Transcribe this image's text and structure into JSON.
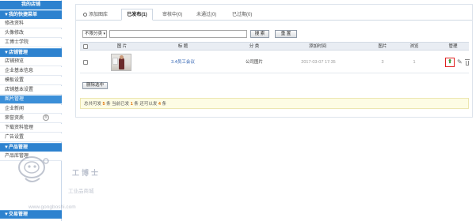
{
  "sidebar": {
    "header": "我的店铺",
    "sections": [
      {
        "label": "▼我的快捷菜单"
      },
      {
        "label": "▼店铺管理"
      },
      {
        "label": "▼产品管理"
      },
      {
        "label": "▼交易管理"
      }
    ],
    "items": [
      {
        "label": "修改资料"
      },
      {
        "label": "头像修改"
      },
      {
        "label": "工博士学院"
      },
      {
        "label": "店铺预览"
      },
      {
        "label": "企业基本信息"
      },
      {
        "label": "模板设置"
      },
      {
        "label": "店铺基本设置"
      },
      {
        "label": "图片管理"
      },
      {
        "label": "企业新闻"
      },
      {
        "label": "荣誉资质"
      },
      {
        "label": "下载资料管理"
      },
      {
        "label": "广告设置"
      },
      {
        "label": "产品库管理"
      }
    ],
    "badge": "®"
  },
  "tabs": {
    "add": "添加图库",
    "published": "已发布(1)",
    "reviewing": "审核中(0)",
    "rejected": "未通过(0)",
    "expired": "已过期(0)"
  },
  "filter": {
    "category": "不限分类",
    "search_value": "",
    "search_button": "搜 索",
    "reset_button": "重 置"
  },
  "table": {
    "columns": {
      "image": "图 片",
      "title": "标 题",
      "category": "分 类",
      "added_time": "添加时间",
      "pictures": "图片",
      "views": "浏览",
      "manage": "管理"
    },
    "rows": [
      {
        "title": "3.4员工会议",
        "category": "公司图片",
        "added_time": "2017-03-07 17:35",
        "pictures": "3",
        "views": "1",
        "thumb_icon": "meeting-photo"
      }
    ],
    "action_icons": [
      "publish-icon",
      "edit-icon",
      "delete-icon"
    ],
    "accent_color": "#e02020"
  },
  "bulk": {
    "delete_selected": "删除选中"
  },
  "summary": {
    "p1": "总共可发",
    "total": "5",
    "p2": "条  当前已发",
    "current": "1",
    "p3": "条  还可以发",
    "remaining": "4",
    "p4": "条"
  },
  "watermark": {
    "name": "工博士",
    "subtitle": "工业品商城",
    "url": "www.gongboshi.com"
  }
}
